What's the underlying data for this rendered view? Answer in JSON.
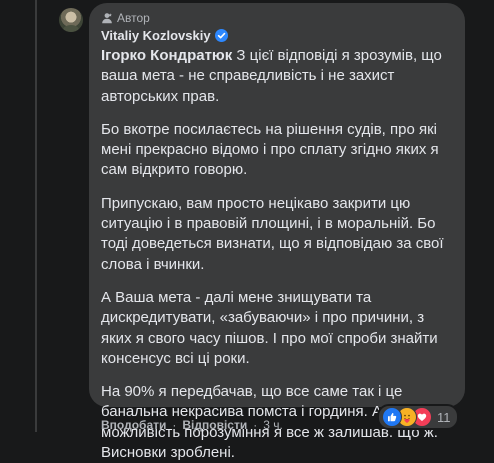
{
  "comment": {
    "badge_label": "Автор",
    "author_name": "Vitaliy Kozlovskiy",
    "mention": "Ігорко Кондратюк",
    "paragraph_1_rest": " З цієї відповіді я зрозумів, що ваша мета - не справедливість і не захист авторських прав.",
    "paragraph_2": "Бо вкотре посилаєтесь на рішення судів, про які мені прекрасно відомо і про сплату згідно яких я сам відкрито говорю.",
    "paragraph_3": "Припускаю, вам просто нецікаво закрити цю ситуацію і в правовій площині, і в моральній. Бо тоді доведеться визнати, що я відповідаю за свої слова і вчинки.",
    "paragraph_4": "А Ваша мета - далі мене знищувати та дискредитувати, «забуваючи» і про причини, з яких я свого часу пішов. І про мої спроби знайти консенсус всі ці роки.",
    "paragraph_5": "На 90% я передбачав, що все саме так і це банальна некрасива помста і гординя. Але 10% на можливість порозуміння я все ж залишав. Що ж. Висновки зроблені."
  },
  "reactions": {
    "icons": [
      "like-icon",
      "care-icon",
      "love-icon"
    ],
    "count": "11"
  },
  "actions": {
    "like_label": "Вподобати",
    "reply_label": "Відповісти",
    "separator": "·",
    "time": "3 ч."
  },
  "colors": {
    "background": "#18191a",
    "bubble": "#3a3b3c",
    "text": "#e4e6eb",
    "muted": "#b0b3b8",
    "verified": "#2d88ff"
  }
}
